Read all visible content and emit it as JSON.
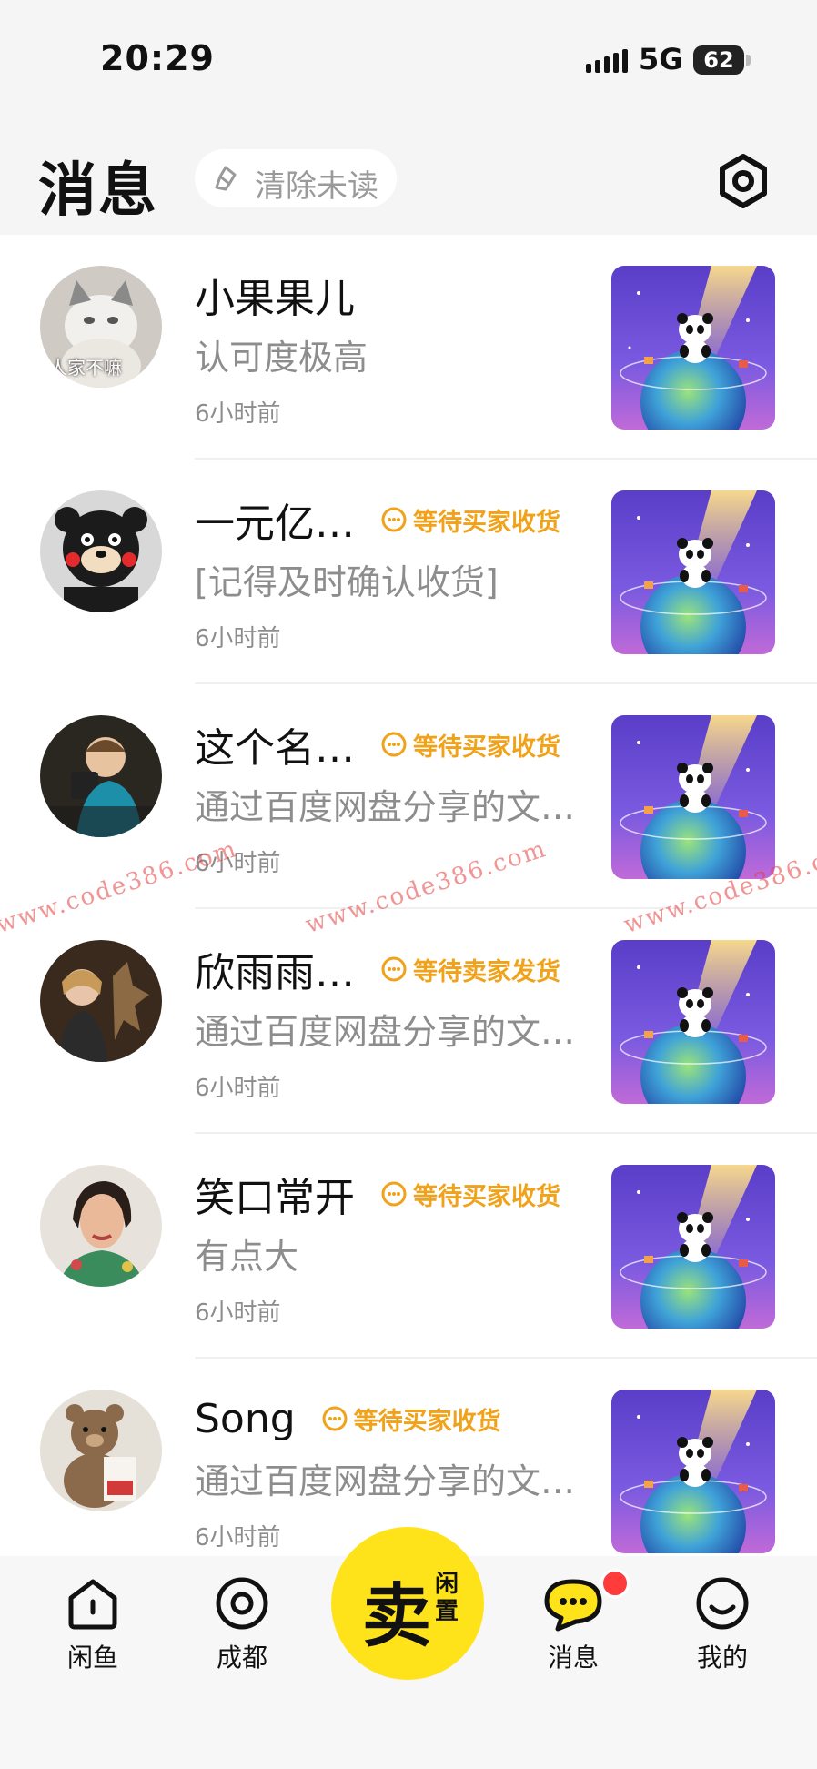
{
  "status_bar": {
    "time": "20:29",
    "network": "5G",
    "battery": "62"
  },
  "header": {
    "title": "消息",
    "clear_unread": "清除未读"
  },
  "conversations": [
    {
      "name": "小果果儿",
      "status": "",
      "message": "认可度极高",
      "time": "6小时前",
      "avatar_caption": "人家不嘛"
    },
    {
      "name": "一元亿…",
      "status": "等待买家收货",
      "message": "[记得及时确认收货]",
      "time": "6小时前"
    },
    {
      "name": "这个名…",
      "status": "等待买家收货",
      "message": "通过百度网盘分享的文…",
      "time": "6小时前"
    },
    {
      "name": "欣雨雨…",
      "status": "等待卖家发货",
      "message": "通过百度网盘分享的文…",
      "time": "6小时前"
    },
    {
      "name": "笑口常开",
      "status": "等待买家收货",
      "message": "有点大",
      "time": "6小时前"
    },
    {
      "name": "Song",
      "status": "等待买家收货",
      "message": "通过百度网盘分享的文…",
      "time": "6小时前"
    }
  ],
  "watermark": "www.code386.com",
  "tab_bar": {
    "home": "闲鱼",
    "city": "成都",
    "sell_main": "卖",
    "sell_sub": "闲置",
    "messages": "消息",
    "mine": "我的"
  },
  "colors": {
    "accent_yellow": "#ffe31a",
    "badge_orange": "#f0a21a",
    "notify_red": "#ff3b3b"
  }
}
